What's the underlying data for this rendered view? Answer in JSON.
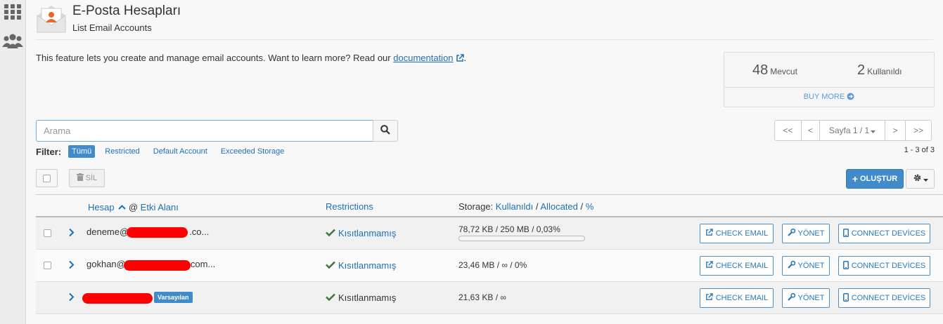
{
  "page": {
    "title": "E-Posta Hesapları",
    "subtitle": "List Email Accounts",
    "description_text": "This feature lets you create and manage email accounts. Want to learn more? Read our",
    "documentation_link": "documentation",
    "description_end": "."
  },
  "stats": {
    "available_count": "48",
    "available_label": "Mevcut",
    "used_count": "2",
    "used_label": "Kullanıldı",
    "buy_more": "BUY MORE"
  },
  "search": {
    "placeholder": "Arama"
  },
  "filter": {
    "label": "Filter:",
    "options": [
      "Tümü",
      "Restricted",
      "Default Account",
      "Exceeded Storage"
    ],
    "active": "Tümü"
  },
  "pagination": {
    "first": "<<",
    "prev": "<",
    "page_label": "Sayfa 1 / 1",
    "next": ">",
    "last": ">>",
    "count_text": "1 - 3 of 3"
  },
  "toolbar": {
    "delete_label": "SİL",
    "create_label": "OLUŞTUR"
  },
  "table": {
    "headers": {
      "account": "Hesap",
      "at_domain": "@",
      "domain": "Etki Alanı",
      "restrictions": "Restrictions",
      "storage_prefix": "Storage:",
      "used": "Kullanıldı",
      "allocated": "Allocated",
      "percent": "%"
    },
    "rows": [
      {
        "email_prefix": "deneme@",
        "email_suffix": ".co...",
        "restriction": "Kısıtlanmamış",
        "storage": "78,72 KB / 250 MB / 0,03%",
        "usage_fraction": 0.0003
      },
      {
        "email_prefix": "gokhan@",
        "email_suffix": "com...",
        "restriction": "Kısıtlanmamış",
        "storage": "23,46 MB / ∞ / 0%"
      },
      {
        "email_prefix": "",
        "email_suffix": "",
        "badge": "Varsayılan",
        "restriction": "Kısıtlanmamış",
        "storage": "21,63 KB / ∞"
      }
    ],
    "actions": {
      "check_email": "CHECK EMAIL",
      "manage": "YÖNET",
      "connect_devices": "CONNECT DEVİCES"
    }
  },
  "colors": {
    "accent": "#428bca",
    "link": "#1e6fb5",
    "success": "#3c763d",
    "redaction": "#ff0000"
  }
}
